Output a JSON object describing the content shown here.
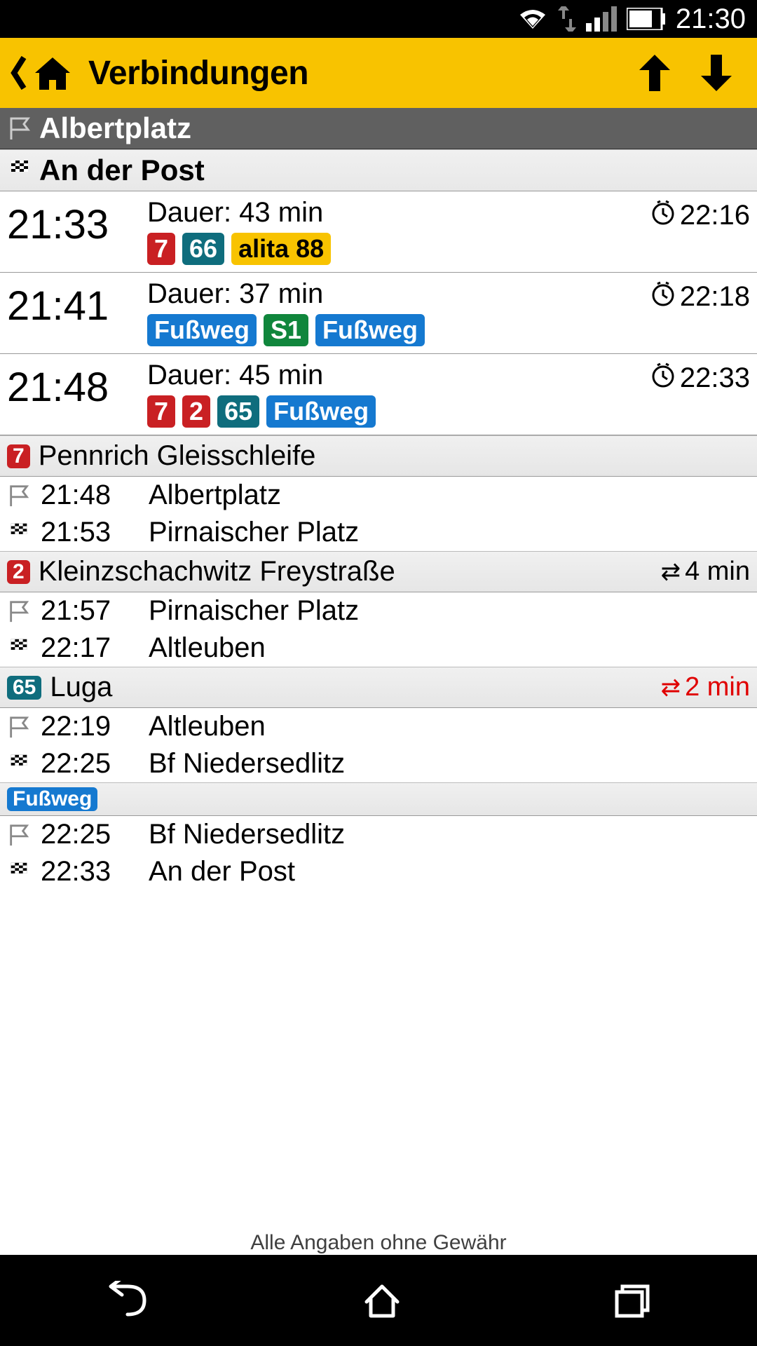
{
  "status": {
    "time": "21:30"
  },
  "appbar": {
    "title": "Verbindungen"
  },
  "origin": "Albertplatz",
  "destination": "An der Post",
  "colors": {
    "red": "#c92023",
    "teal": "#0f6d7d",
    "yellow": "#f8c300",
    "blue": "#1579d0",
    "green": "#10863c"
  },
  "connections": [
    {
      "depart": "21:33",
      "duration": "Dauer: 43 min",
      "arrive": "22:16",
      "lines": [
        {
          "label": "7",
          "color": "red"
        },
        {
          "label": "66",
          "color": "teal"
        },
        {
          "label": "alita 88",
          "color": "yellow"
        }
      ]
    },
    {
      "depart": "21:41",
      "duration": "Dauer: 37 min",
      "arrive": "22:18",
      "lines": [
        {
          "label": "Fußweg",
          "color": "blue"
        },
        {
          "label": "S1",
          "color": "green"
        },
        {
          "label": "Fußweg",
          "color": "blue"
        }
      ]
    },
    {
      "depart": "21:48",
      "duration": "Dauer: 45 min",
      "arrive": "22:33",
      "lines": [
        {
          "label": "7",
          "color": "red"
        },
        {
          "label": "2",
          "color": "red"
        },
        {
          "label": "65",
          "color": "teal"
        },
        {
          "label": "Fußweg",
          "color": "blue"
        }
      ]
    }
  ],
  "legs": [
    {
      "header_badge": {
        "label": "7",
        "color": "red"
      },
      "header_dest": "Pennrich Gleisschleife",
      "transfer": "",
      "transfer_color": "",
      "rows": [
        {
          "icon": "start",
          "time": "21:48",
          "stop": "Albertplatz"
        },
        {
          "icon": "end",
          "time": "21:53",
          "stop": "Pirnaischer Platz"
        }
      ]
    },
    {
      "header_badge": {
        "label": "2",
        "color": "red"
      },
      "header_dest": "Kleinzschachwitz Freystraße",
      "transfer": "4 min",
      "transfer_color": "#000",
      "rows": [
        {
          "icon": "start",
          "time": "21:57",
          "stop": "Pirnaischer Platz"
        },
        {
          "icon": "end",
          "time": "22:17",
          "stop": "Altleuben"
        }
      ]
    },
    {
      "header_badge": {
        "label": "65",
        "color": "teal"
      },
      "header_dest": "Luga",
      "transfer": "2 min",
      "transfer_color": "#e00000",
      "rows": [
        {
          "icon": "start",
          "time": "22:19",
          "stop": "Altleuben"
        },
        {
          "icon": "end",
          "time": "22:25",
          "stop": "Bf Niedersedlitz"
        }
      ]
    },
    {
      "header_badge": {
        "label": "Fußweg",
        "color": "blue"
      },
      "header_dest": "",
      "transfer": "",
      "transfer_color": "",
      "rows": [
        {
          "icon": "start",
          "time": "22:25",
          "stop": "Bf Niedersedlitz"
        },
        {
          "icon": "end",
          "time": "22:33",
          "stop": "An der Post"
        }
      ]
    }
  ],
  "footer": "Alle Angaben ohne Gewähr"
}
